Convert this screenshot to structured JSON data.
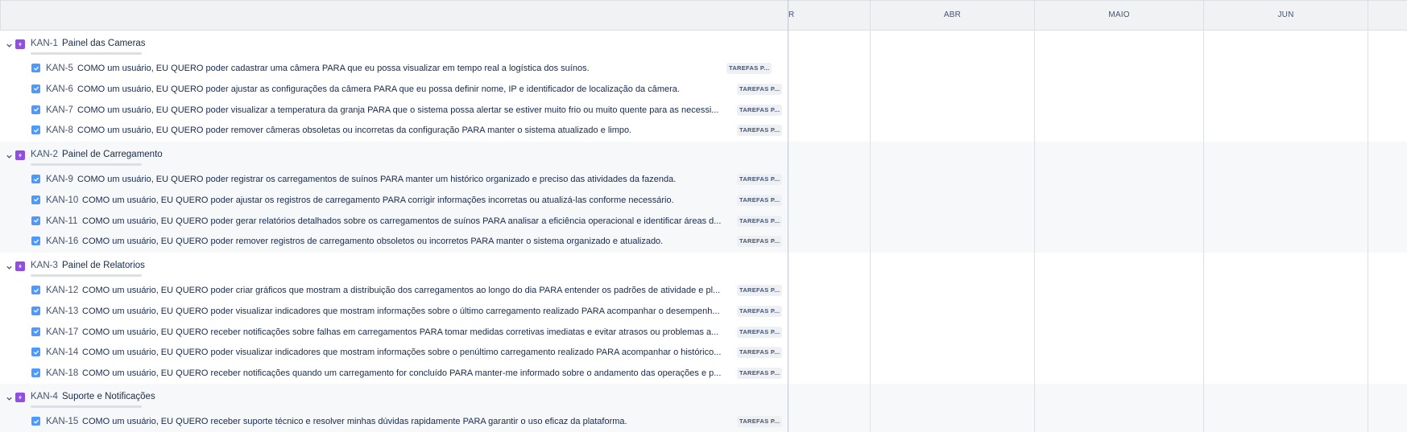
{
  "timeline": {
    "months": [
      "R",
      "ABR",
      "MAIO",
      "JUN"
    ]
  },
  "status_label": "TAREFAS P...",
  "status_label_short": "TAREFAS P...",
  "epics": [
    {
      "key": "KAN-1",
      "title": "Painel das Cameras",
      "tasks": [
        {
          "key": "KAN-5",
          "title": "COMO um usuário, EU QUERO poder cadastrar uma câmera PARA que eu possa visualizar em tempo real a logística dos suínos."
        },
        {
          "key": "KAN-6",
          "title": "COMO um usuário, EU QUERO poder ajustar as configurações da câmera PARA que eu possa definir nome, IP e identificador de localização da câmera."
        },
        {
          "key": "KAN-7",
          "title": "COMO um usuário, EU QUERO poder visualizar a temperatura da granja PARA que o sistema possa alertar se estiver muito frio ou muito quente para as necessi..."
        },
        {
          "key": "KAN-8",
          "title": "COMO um usuário, EU QUERO poder remover câmeras obsoletas ou incorretas da configuração PARA manter o sistema atualizado e limpo."
        }
      ]
    },
    {
      "key": "KAN-2",
      "title": "Painel de Carregamento",
      "tasks": [
        {
          "key": "KAN-9",
          "title": "COMO um usuário, EU QUERO poder registrar os carregamentos de suínos PARA manter um histórico organizado e preciso das atividades da fazenda."
        },
        {
          "key": "KAN-10",
          "title": "COMO um usuário, EU QUERO poder ajustar os registros de carregamento PARA corrigir informações incorretas ou atualizá-las conforme necessário."
        },
        {
          "key": "KAN-11",
          "title": "COMO um usuário, EU QUERO poder gerar relatórios detalhados sobre os carregamentos de suínos PARA analisar a eficiência operacional e identificar áreas d..."
        },
        {
          "key": "KAN-16",
          "title": "COMO um usuário, EU QUERO poder remover registros de carregamento obsoletos ou incorretos PARA manter o sistema organizado e atualizado."
        }
      ]
    },
    {
      "key": "KAN-3",
      "title": "Painel de Relatorios",
      "tasks": [
        {
          "key": "KAN-12",
          "title": "COMO um usuário, EU QUERO poder criar gráficos que mostram a distribuição dos carregamentos ao longo do dia PARA entender os padrões de atividade e pl..."
        },
        {
          "key": "KAN-13",
          "title": "COMO um usuário, EU QUERO poder visualizar indicadores que mostram informações sobre o último carregamento realizado PARA acompanhar o desempenh..."
        },
        {
          "key": "KAN-17",
          "title": "COMO um usuário, EU QUERO receber notificações sobre falhas em carregamentos PARA tomar medidas corretivas imediatas e evitar atrasos ou problemas a..."
        },
        {
          "key": "KAN-14",
          "title": "COMO um usuário, EU QUERO poder visualizar indicadores que mostram informações sobre o penúltimo carregamento realizado PARA acompanhar o histórico..."
        },
        {
          "key": "KAN-18",
          "title": "COMO um usuário, EU QUERO receber notificações quando um carregamento for concluído PARA manter-me informado sobre o andamento das operações e p..."
        }
      ]
    },
    {
      "key": "KAN-4",
      "title": "Suporte e Notificações",
      "tasks": [
        {
          "key": "KAN-15",
          "title": "COMO um usuário, EU QUERO receber suporte técnico e resolver minhas dúvidas rapidamente PARA garantir o uso eficaz da plataforma."
        }
      ]
    }
  ],
  "colors": {
    "epic": "#904ee2",
    "task_check": "#4c9aff",
    "band_gray": "#f7f8f9"
  }
}
